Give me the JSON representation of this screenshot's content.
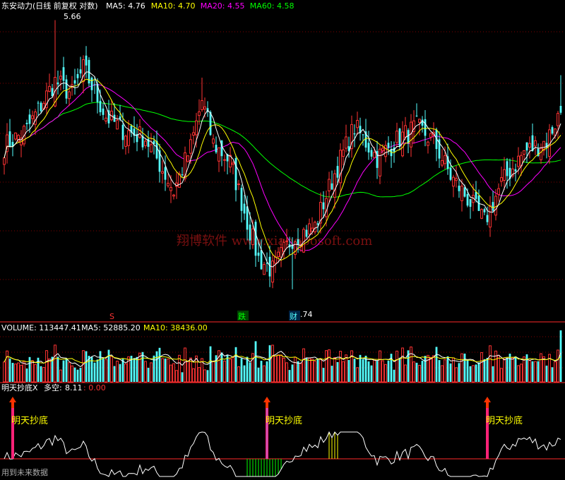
{
  "header": {
    "title": "东安动力(日线 前复权 对数)",
    "ma_items": [
      {
        "label": "MA5:",
        "value": "4.76",
        "color": "#ffffff"
      },
      {
        "label": "MA10:",
        "value": "4.70",
        "color": "#ffff00"
      },
      {
        "label": "MA20:",
        "value": "4.55",
        "color": "#ff00ff"
      },
      {
        "label": "MA60:",
        "value": "4.58",
        "color": "#00ff00"
      }
    ]
  },
  "markers": {
    "high_label": "5.66",
    "low_label": "3.74",
    "s_mark": "S",
    "die_mark": "跌",
    "cai_mark": "财"
  },
  "watermark": "翔博软件  www.xiangbosoft.com",
  "volume_header": {
    "items": [
      {
        "label": "VOLUME:",
        "value": "113447.41",
        "color": "#ffffff"
      },
      {
        "label": "MA5:",
        "value": "52885.20",
        "color": "#ffffff"
      },
      {
        "label": "MA10:",
        "value": "38436.00",
        "color": "#ffff00"
      }
    ]
  },
  "indicator_header": {
    "name": "明天抄底X",
    "duokong_label": "多空:",
    "duokong_value": "8.11",
    "extra_value": ": 0.00"
  },
  "signals": [
    {
      "text": "明天抄底",
      "bar_index": 3
    },
    {
      "text": "明天抄底",
      "bar_index": 93
    },
    {
      "text": "明天抄底",
      "bar_index": 171
    }
  ],
  "footer_text": "用到未来数据",
  "colors": {
    "up": "#ff3333",
    "down": "#54ffff",
    "ma5": "#ffffff",
    "ma10": "#ffff00",
    "ma20": "#ff00ff",
    "ma60": "#00ff00",
    "grid": "#800000",
    "divider": "#ff2a2a",
    "signal_bar": "#ff2277",
    "signal_text": "#ffff00"
  },
  "chart_data": {
    "type": "candlestick",
    "bar_count": 198,
    "y_scale": "log",
    "price_range": [
      3.6,
      5.7
    ],
    "anchors": [
      {
        "i": 0,
        "close": 4.66
      },
      {
        "i": 8,
        "close": 4.78
      },
      {
        "i": 18,
        "close": 5.15
      },
      {
        "i": 24,
        "close": 5.05
      },
      {
        "i": 28,
        "close": 5.25
      },
      {
        "i": 36,
        "close": 4.88
      },
      {
        "i": 42,
        "close": 4.78
      },
      {
        "i": 50,
        "close": 4.72
      },
      {
        "i": 60,
        "close": 4.35
      },
      {
        "i": 66,
        "close": 4.65
      },
      {
        "i": 70,
        "close": 5.0
      },
      {
        "i": 74,
        "close": 4.68
      },
      {
        "i": 80,
        "close": 4.55
      },
      {
        "i": 86,
        "close": 4.15
      },
      {
        "i": 90,
        "close": 3.92
      },
      {
        "i": 95,
        "close": 3.85
      },
      {
        "i": 102,
        "close": 4.05
      },
      {
        "i": 110,
        "close": 4.12
      },
      {
        "i": 118,
        "close": 4.52
      },
      {
        "i": 124,
        "close": 4.8
      },
      {
        "i": 132,
        "close": 4.58
      },
      {
        "i": 140,
        "close": 4.72
      },
      {
        "i": 146,
        "close": 4.8
      },
      {
        "i": 152,
        "close": 4.7
      },
      {
        "i": 158,
        "close": 4.45
      },
      {
        "i": 164,
        "close": 4.3
      },
      {
        "i": 170,
        "close": 4.15
      },
      {
        "i": 176,
        "close": 4.4
      },
      {
        "i": 184,
        "close": 4.62
      },
      {
        "i": 192,
        "close": 4.7
      },
      {
        "i": 197,
        "close": 4.92
      }
    ],
    "volume_range": [
      0,
      113447.41
    ],
    "last_volume": 113447.41
  }
}
